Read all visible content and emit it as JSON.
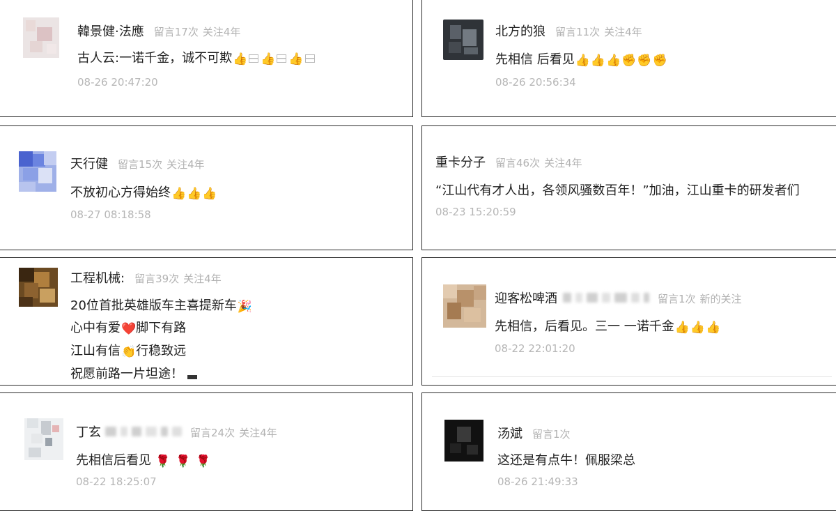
{
  "comments": [
    {
      "name": "韓景健·法應",
      "stats": [
        "留言17次",
        "关注4年"
      ],
      "lines": [
        "古人云:一诺千金，诚不可欺"
      ],
      "emojis": [
        "👍",
        "▤",
        "👍",
        "▤",
        "👍",
        "▤"
      ],
      "time": "08-26 20:47:20"
    },
    {
      "name": "北方的狼",
      "stats": [
        "留言11次",
        "关注4年"
      ],
      "lines": [
        "先相信  后看见"
      ],
      "emojis": [
        "👍",
        "👍",
        "👍",
        "✊",
        "✊",
        "✊"
      ],
      "time": "08-26 20:56:34"
    },
    {
      "name": "天行健",
      "stats": [
        "留言15次",
        "关注4年"
      ],
      "lines": [
        "不放初心方得始终"
      ],
      "emojis": [
        "👍",
        "👍",
        "👍"
      ],
      "time": "08-27 08:18:58"
    },
    {
      "name": "重卡分子",
      "stats": [
        "留言46次",
        "关注4年"
      ],
      "lines": [
        "“江山代有才人出，各领风骚数百年！”加油，江山重卡的研发者们"
      ],
      "time": "08-23 15:20:59"
    },
    {
      "name": "工程机械:",
      "stats": [
        "留言39次",
        "关注4年"
      ],
      "lines": [
        "20位首批英雄版车主喜提新车",
        "心中有爱",
        "脚下有路",
        "江山有信",
        "行稳致远",
        "祝愿前路一片坦途！"
      ],
      "emojis": [
        "🎉",
        "❤️",
        "👏"
      ]
    },
    {
      "name": "迎客松啤酒",
      "stats": [
        "留言1次",
        "新的关注"
      ],
      "lines": [
        "先相信，后看见。三一  一诺千金"
      ],
      "emojis": [
        "👍",
        "👍",
        "👍"
      ],
      "time": "08-22 22:01:20"
    },
    {
      "name": "丁玄",
      "stats": [
        "留言24次",
        "关注4年"
      ],
      "lines": [
        "先相信后看见"
      ],
      "emojis": [
        "🌹",
        "🌹",
        "🌹"
      ],
      "time": "08-22 18:25:07"
    },
    {
      "name": "汤斌",
      "stats": [
        "留言1次"
      ],
      "lines": [
        "这还是有点牛！佩服梁总"
      ],
      "time": "08-26 21:49:33"
    }
  ]
}
